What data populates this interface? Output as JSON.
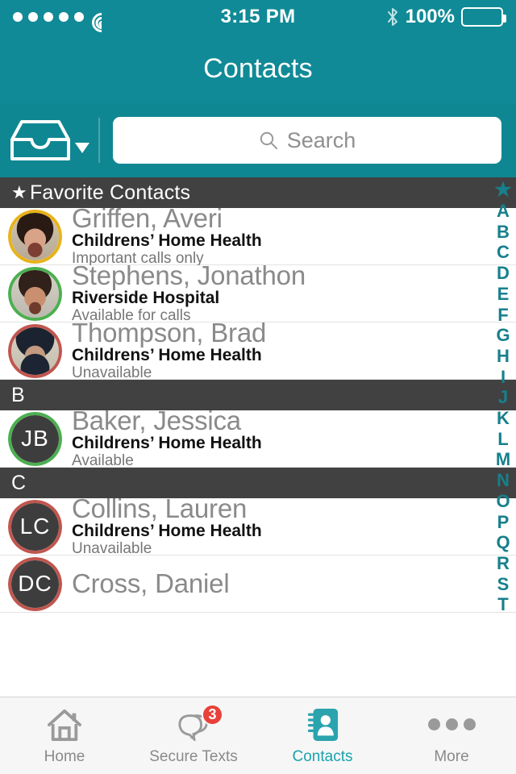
{
  "status_bar": {
    "signal_dots": 5,
    "wifi_icon": "wifi-icon",
    "time": "3:15 PM",
    "bluetooth_icon": "bluetooth-icon",
    "battery_percent": "100%",
    "battery_icon": "battery-full-icon"
  },
  "nav": {
    "title": "Contacts"
  },
  "search": {
    "tray_icon": "inbox-tray-icon",
    "tray_caret_icon": "caret-down-icon",
    "search_icon": "search-icon",
    "placeholder": "Search",
    "value": ""
  },
  "colors": {
    "teal": "#108a96",
    "teal_dark": "#0f8792",
    "accent": "#17a3ad",
    "index_teal": "#17808c",
    "section_gray": "#414141",
    "badge_red": "#e8413a",
    "ring_available": "#4caf50",
    "ring_important": "#e8b219",
    "ring_unavailable": "#c0564f",
    "avatar_placeholder": "#3d3d3d"
  },
  "sections": [
    {
      "header": "Favorite Contacts",
      "header_icon": "star-icon",
      "contacts": [
        {
          "name": "Griffen, Averi",
          "org": "Childrens’ Home Health",
          "status": "Important calls only",
          "ring": "#e8b219",
          "avatar_type": "photo",
          "photo": "woman-smiling",
          "initials": ""
        },
        {
          "name": "Stephens, Jonathon",
          "org": "Riverside Hospital",
          "status": "Available for calls",
          "ring": "#4caf50",
          "avatar_type": "photo",
          "photo": "man-smiling",
          "initials": ""
        },
        {
          "name": "Thompson, Brad",
          "org": "Childrens’ Home Health",
          "status": "Unavailable",
          "ring": "#c0564f",
          "avatar_type": "photo",
          "photo": "man-beanie",
          "initials": ""
        }
      ]
    },
    {
      "header": "B",
      "header_icon": "",
      "contacts": [
        {
          "name": "Baker, Jessica",
          "org": "Childrens’ Home Health",
          "status": "Available",
          "ring": "#4caf50",
          "avatar_type": "initials",
          "photo": "",
          "initials": "JB"
        }
      ]
    },
    {
      "header": "C",
      "header_icon": "",
      "contacts": [
        {
          "name": "Collins, Lauren",
          "org": "Childrens’ Home Health",
          "status": "Unavailable",
          "ring": "#c0564f",
          "avatar_type": "initials",
          "photo": "",
          "initials": "LC"
        },
        {
          "name": "Cross, Daniel",
          "org": "",
          "status": "",
          "ring": "#c0564f",
          "avatar_type": "initials",
          "photo": "",
          "initials": "DC"
        }
      ]
    }
  ],
  "alpha_index": [
    "★",
    "A",
    "B",
    "C",
    "D",
    "E",
    "F",
    "G",
    "H",
    "I",
    "J",
    "K",
    "L",
    "M",
    "N",
    "O",
    "P",
    "Q",
    "R",
    "S",
    "T"
  ],
  "tabs": [
    {
      "label": "Home",
      "icon": "home-icon",
      "active": false,
      "badge": ""
    },
    {
      "label": "Secure Texts",
      "icon": "chat-bubbles-icon",
      "active": false,
      "badge": "3"
    },
    {
      "label": "Contacts",
      "icon": "address-book-icon",
      "active": true,
      "badge": ""
    },
    {
      "label": "More",
      "icon": "ellipsis-icon",
      "active": false,
      "badge": ""
    }
  ]
}
